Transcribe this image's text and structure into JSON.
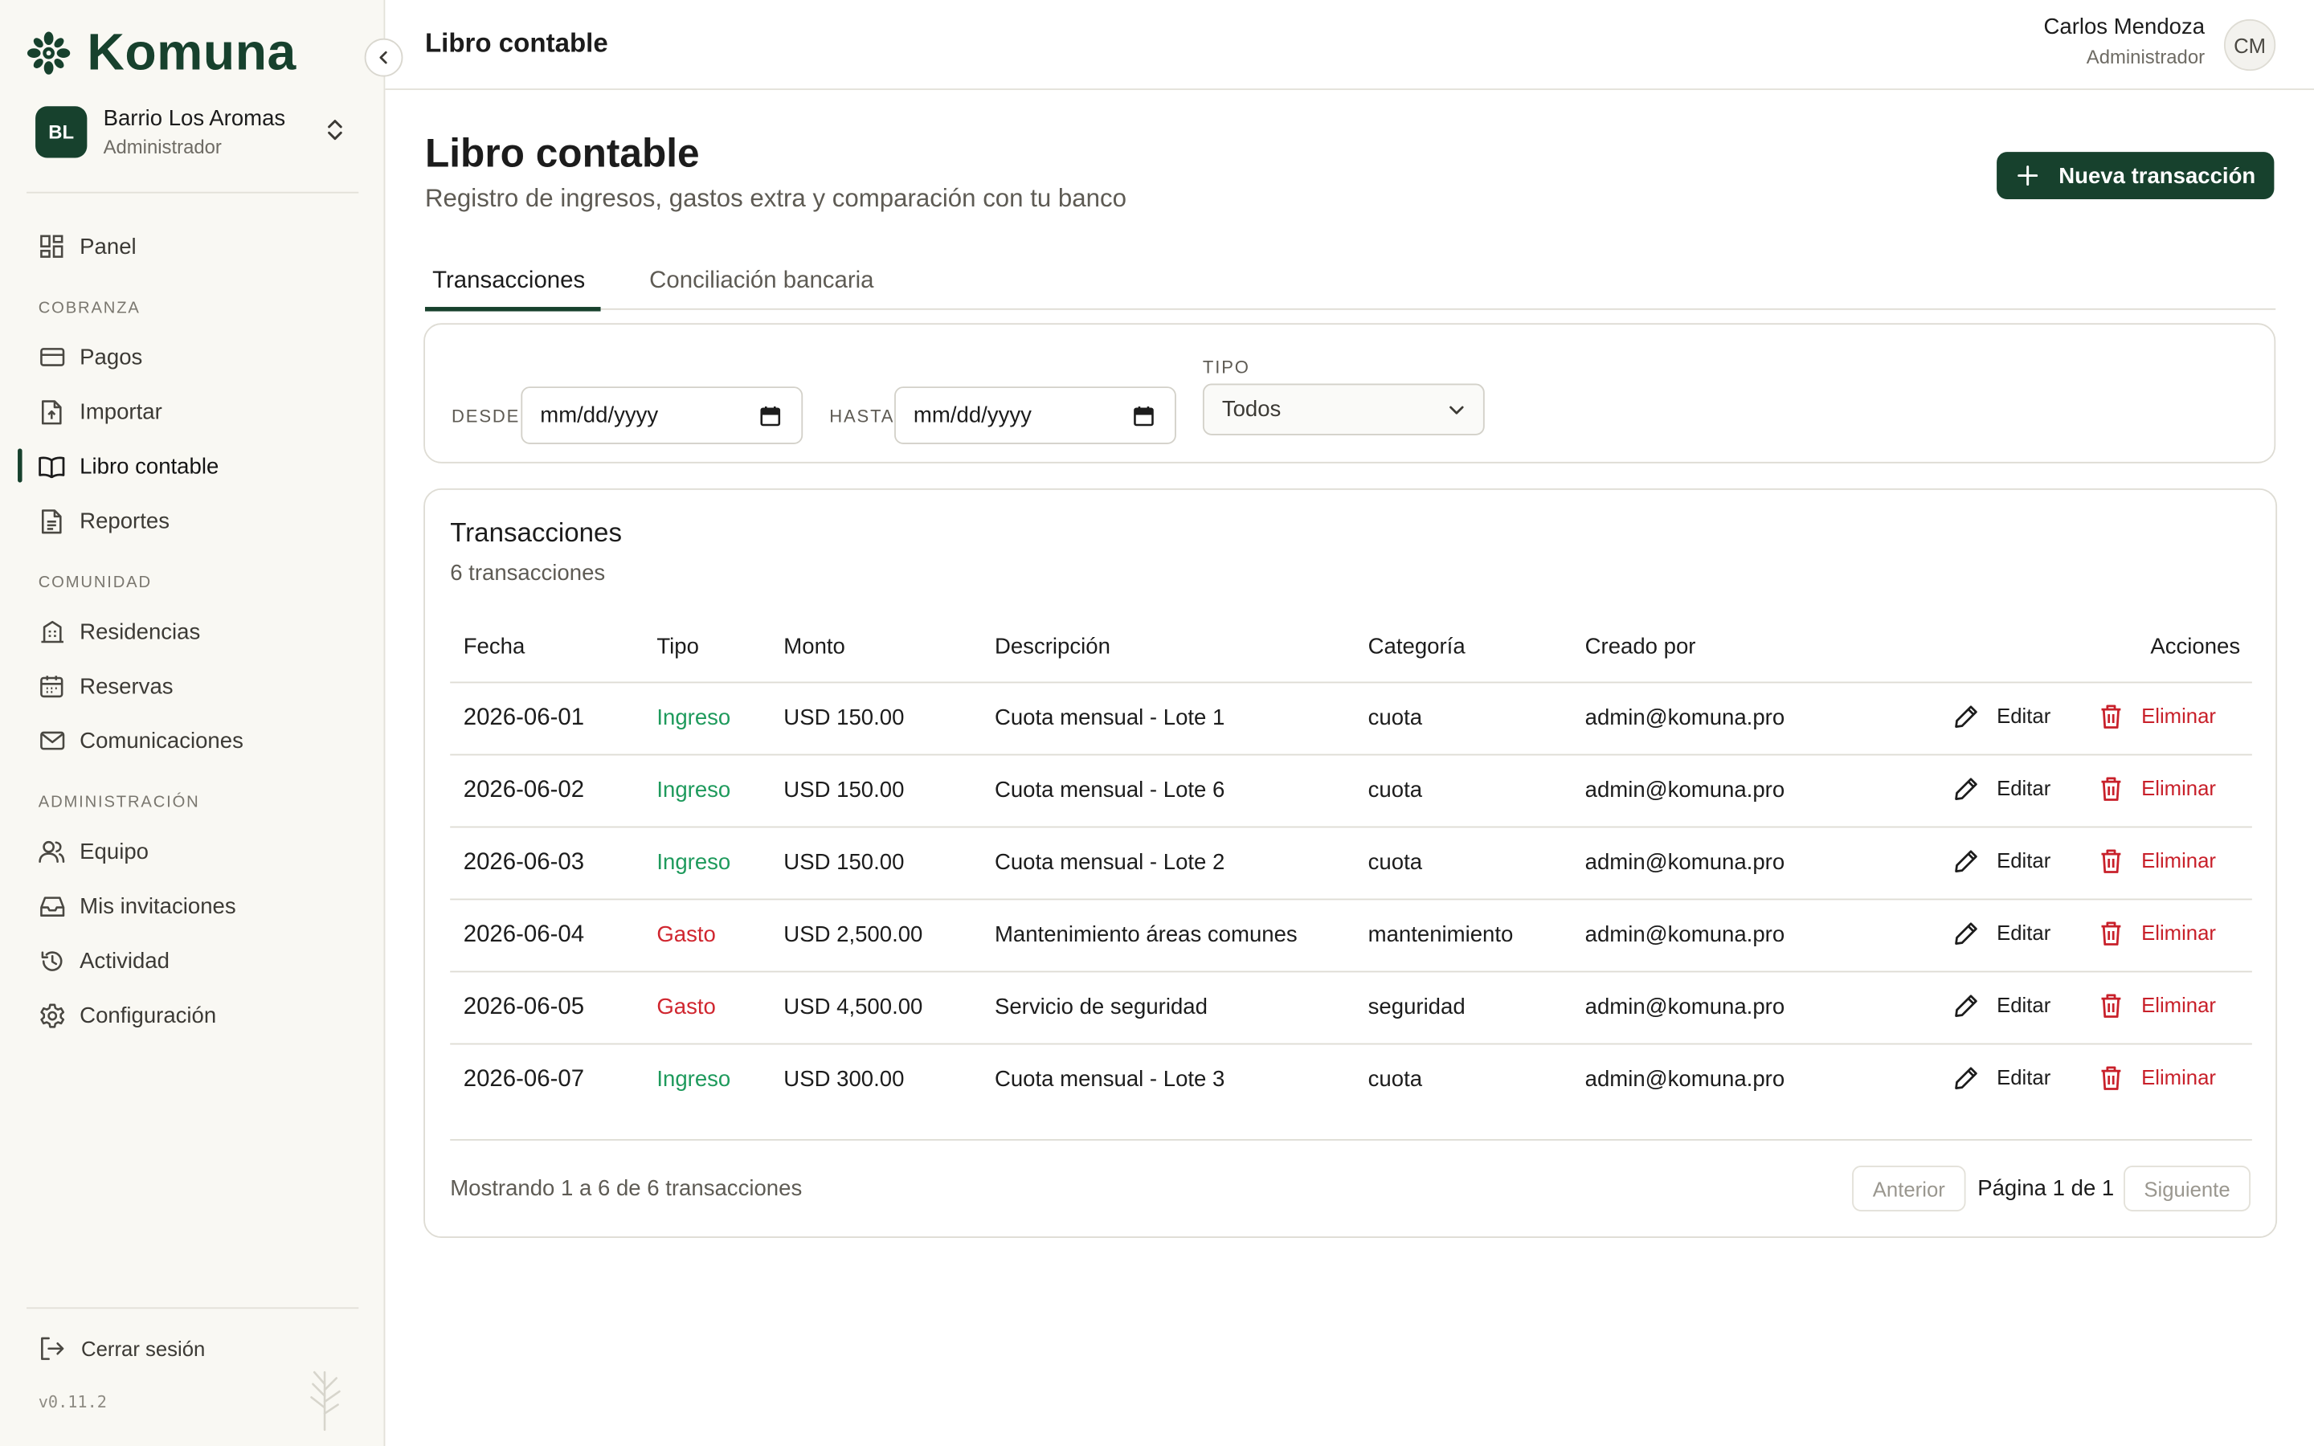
{
  "brand": {
    "name": "Komuna"
  },
  "org": {
    "badge": "BL",
    "name": "Barrio Los Aromas",
    "role": "Administrador"
  },
  "nav": {
    "panel": "Panel",
    "sections": {
      "cobranza": "COBRANZA",
      "comunidad": "COMUNIDAD",
      "administracion": "ADMINISTRACIÓN"
    },
    "pagos": "Pagos",
    "importar": "Importar",
    "libro": "Libro contable",
    "reportes": "Reportes",
    "residencias": "Residencias",
    "reservas": "Reservas",
    "comunicaciones": "Comunicaciones",
    "equipo": "Equipo",
    "invitaciones": "Mis invitaciones",
    "actividad": "Actividad",
    "configuracion": "Configuración",
    "logout": "Cerrar sesión",
    "version": "v0.11.2"
  },
  "header": {
    "title": "Libro contable",
    "user_name": "Carlos Mendoza",
    "user_role": "Administrador",
    "avatar": "CM"
  },
  "page": {
    "title": "Libro contable",
    "subtitle": "Registro de ingresos, gastos extra y comparación con tu banco",
    "new_button": "Nueva transacción",
    "tabs": [
      "Transacciones",
      "Conciliación bancaria"
    ]
  },
  "filters": {
    "desde_label": "DESDE",
    "hasta_label": "HASTA",
    "tipo_label": "TIPO",
    "desde_value": "mm/dd/yyyy",
    "hasta_value": "mm/dd/yyyy",
    "tipo_value": "Todos"
  },
  "table": {
    "title": "Transacciones",
    "count": "6 transacciones",
    "columns": [
      "Fecha",
      "Tipo",
      "Monto",
      "Descripción",
      "Categoría",
      "Creado por",
      "Acciones"
    ],
    "edit_label": "Editar",
    "delete_label": "Eliminar",
    "rows": [
      {
        "fecha": "2026-06-01",
        "tipo": "Ingreso",
        "monto": "USD 150.00",
        "descripcion": "Cuota mensual - Lote 1",
        "categoria": "cuota",
        "creado": "admin@komuna.pro"
      },
      {
        "fecha": "2026-06-02",
        "tipo": "Ingreso",
        "monto": "USD 150.00",
        "descripcion": "Cuota mensual - Lote 6",
        "categoria": "cuota",
        "creado": "admin@komuna.pro"
      },
      {
        "fecha": "2026-06-03",
        "tipo": "Ingreso",
        "monto": "USD 150.00",
        "descripcion": "Cuota mensual - Lote 2",
        "categoria": "cuota",
        "creado": "admin@komuna.pro"
      },
      {
        "fecha": "2026-06-04",
        "tipo": "Gasto",
        "monto": "USD 2,500.00",
        "descripcion": "Mantenimiento áreas comunes",
        "categoria": "mantenimiento",
        "creado": "admin@komuna.pro"
      },
      {
        "fecha": "2026-06-05",
        "tipo": "Gasto",
        "monto": "USD 4,500.00",
        "descripcion": "Servicio de seguridad",
        "categoria": "seguridad",
        "creado": "admin@komuna.pro"
      },
      {
        "fecha": "2026-06-07",
        "tipo": "Ingreso",
        "monto": "USD 300.00",
        "descripcion": "Cuota mensual - Lote 3",
        "categoria": "cuota",
        "creado": "admin@komuna.pro"
      }
    ],
    "footer": "Mostrando 1 a 6 de 6 transacciones",
    "prev": "Anterior",
    "page_info": "Página 1 de 1",
    "next": "Siguiente"
  },
  "colors": {
    "brand": "#17412d",
    "income": "#1e9a5c",
    "expense": "#d0262f"
  }
}
